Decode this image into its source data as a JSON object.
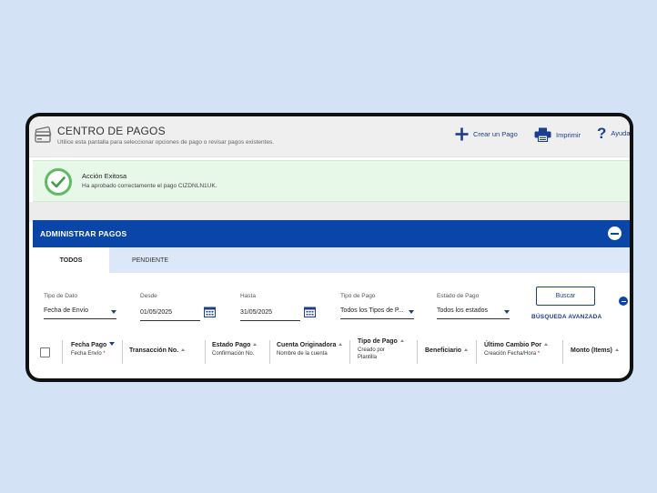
{
  "header": {
    "title": "CENTRO DE PAGOS",
    "subtitle": "Utilice esta pantalla para seleccionar opciones de pago o revisar pagos existentes.",
    "actions": {
      "create": "Crear un Pago",
      "print": "Imprimir",
      "help": "Ayuda"
    }
  },
  "alert": {
    "title": "Acción Exitosa",
    "message": "Ha aprobado correctamente el pago CIZDNLN1UK."
  },
  "panel": {
    "title": "ADMINISTRAR PAGOS",
    "tabs": [
      "TODOS",
      "PENDIENTE"
    ]
  },
  "filters": {
    "tipo_dato": {
      "label": "Tipo de Dato",
      "value": "Fecha de Envío"
    },
    "desde": {
      "label": "Desde",
      "value": "01/05/2025"
    },
    "hasta": {
      "label": "Hasta",
      "value": "31/05/2025"
    },
    "tipo_pago": {
      "label": "Tipo de Pago",
      "value": "Todos los Tipos de P..."
    },
    "estado_pago": {
      "label": "Estado de Pago",
      "value": "Todos los estados"
    },
    "search_button": "Buscar",
    "advanced": "BÚSQUEDA AVANZADA"
  },
  "table": {
    "columns": [
      {
        "header": "Fecha Pago",
        "sub": "Fecha Envío",
        "sub_required": "*"
      },
      {
        "header": "Transacción No.",
        "sub": ""
      },
      {
        "header": "Estado Pago",
        "sub": "Confirmación No."
      },
      {
        "header": "Cuenta Originadora",
        "sub": "Nombre de la cuenta"
      },
      {
        "header": "Tipo de Pago",
        "sub": "Creado por",
        "sub2": "Plantilla"
      },
      {
        "header": "Beneficiario",
        "sub": ""
      },
      {
        "header": "Último Cambio Por",
        "sub": "Creación Fecha/Hora",
        "sub_required": "*"
      },
      {
        "header": "Monto (Items)",
        "sub": ""
      }
    ]
  },
  "colors": {
    "primary": "#0a45a8",
    "link": "#1c3e8f",
    "success_bg": "#e8f8e8",
    "success_icon": "#5dbb63",
    "required": "#c8102e"
  }
}
